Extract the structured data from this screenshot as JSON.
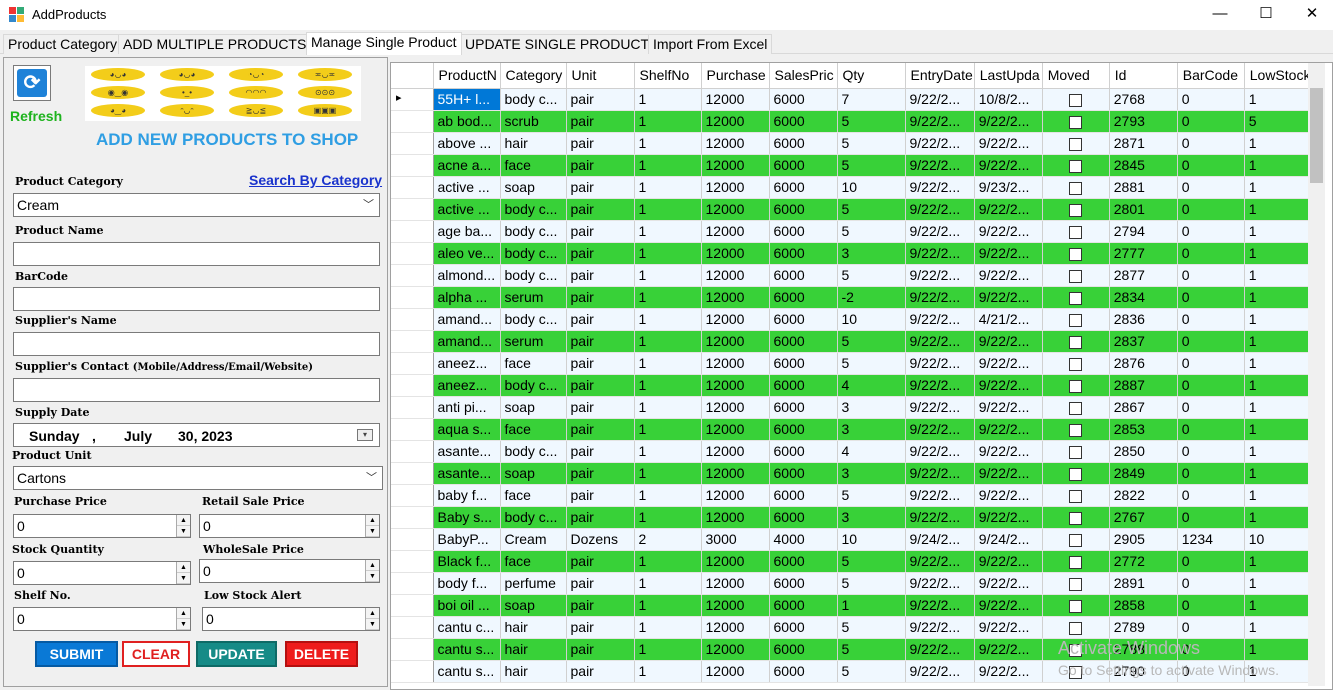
{
  "window": {
    "title": "AddProducts",
    "minimize": "—",
    "maximize": "☐",
    "close": "✕"
  },
  "tabs": [
    {
      "label": "Product Category"
    },
    {
      "label": "ADD MULTIPLE PRODUCTS"
    },
    {
      "label": "Manage Single Product"
    },
    {
      "label": "UPDATE SINGLE PRODUCT"
    },
    {
      "label": "Import From Excel"
    }
  ],
  "form": {
    "refresh_glyph": "⟳",
    "refresh_label": "Refresh",
    "heading": "ADD NEW PRODUCTS TO SHOP",
    "product_category_label": "Product Category",
    "search_by_category": "Search By Category",
    "product_category_value": "Cream",
    "product_name_label": "Product Name",
    "product_name_value": "",
    "barcode_label": "BarCode",
    "barcode_value": "",
    "supplier_name_label": "Supplier's Name",
    "supplier_name_value": "",
    "supplier_contact_label": "Supplier's Contact",
    "supplier_contact_hint": "(Mobile/Address/Email/Website)",
    "supplier_contact_value": "",
    "supply_date_label": "Supply Date",
    "supply_date": {
      "weekday": "Sunday",
      "sep": ",",
      "month": "July",
      "day_year": "30, 2023"
    },
    "product_unit_label": "Product Unit",
    "product_unit_value": "Cartons",
    "purchase_price_label": "Purchase Price",
    "purchase_price_value": "0",
    "retail_sale_price_label": "Retail Sale Price",
    "retail_sale_price_value": "0",
    "stock_quantity_label": "Stock Quantity",
    "stock_quantity_value": "0",
    "wholesale_price_label": "WholeSale Price",
    "wholesale_price_value": "0",
    "shelf_no_label": "Shelf No.",
    "shelf_no_value": "0",
    "low_stock_alert_label": "Low Stock Alert",
    "low_stock_alert_value": "0",
    "buttons": {
      "submit": "SUBMIT",
      "clear": "CLEAR",
      "update": "UPDATE",
      "delete": "DELETE"
    }
  },
  "grid": {
    "columns": [
      "ProductN",
      "Category",
      "Unit",
      "ShelfNo",
      "Purchase",
      "SalesPric",
      "Qty",
      "EntryDate",
      "LastUpda",
      "Moved",
      "Id",
      "BarCode",
      "LowStock"
    ],
    "rows": [
      [
        "55H+ l...",
        "body c...",
        "pair",
        "1",
        "12000",
        "6000",
        "7",
        "9/22/2...",
        "10/8/2...",
        "",
        "2768",
        "0",
        "1"
      ],
      [
        "ab bod...",
        "scrub",
        "pair",
        "1",
        "12000",
        "6000",
        "5",
        "9/22/2...",
        "9/22/2...",
        "",
        "2793",
        "0",
        "5"
      ],
      [
        "above ...",
        "hair",
        "pair",
        "1",
        "12000",
        "6000",
        "5",
        "9/22/2...",
        "9/22/2...",
        "",
        "2871",
        "0",
        "1"
      ],
      [
        "acne a...",
        "face",
        "pair",
        "1",
        "12000",
        "6000",
        "5",
        "9/22/2...",
        "9/22/2...",
        "",
        "2845",
        "0",
        "1"
      ],
      [
        "active ...",
        "soap",
        "pair",
        "1",
        "12000",
        "6000",
        "10",
        "9/22/2...",
        "9/23/2...",
        "",
        "2881",
        "0",
        "1"
      ],
      [
        "active ...",
        "body c...",
        "pair",
        "1",
        "12000",
        "6000",
        "5",
        "9/22/2...",
        "9/22/2...",
        "",
        "2801",
        "0",
        "1"
      ],
      [
        "age ba...",
        "body c...",
        "pair",
        "1",
        "12000",
        "6000",
        "5",
        "9/22/2...",
        "9/22/2...",
        "",
        "2794",
        "0",
        "1"
      ],
      [
        "aleo ve...",
        "body c...",
        "pair",
        "1",
        "12000",
        "6000",
        "3",
        "9/22/2...",
        "9/22/2...",
        "",
        "2777",
        "0",
        "1"
      ],
      [
        "almond...",
        "body c...",
        "pair",
        "1",
        "12000",
        "6000",
        "5",
        "9/22/2...",
        "9/22/2...",
        "",
        "2877",
        "0",
        "1"
      ],
      [
        "alpha ...",
        "serum",
        "pair",
        "1",
        "12000",
        "6000",
        "-2",
        "9/22/2...",
        "9/22/2...",
        "",
        "2834",
        "0",
        "1"
      ],
      [
        "amand...",
        "body c...",
        "pair",
        "1",
        "12000",
        "6000",
        "10",
        "9/22/2...",
        "4/21/2...",
        "",
        "2836",
        "0",
        "1"
      ],
      [
        "amand...",
        "serum",
        "pair",
        "1",
        "12000",
        "6000",
        "5",
        "9/22/2...",
        "9/22/2...",
        "",
        "2837",
        "0",
        "1"
      ],
      [
        "aneez...",
        "face",
        "pair",
        "1",
        "12000",
        "6000",
        "5",
        "9/22/2...",
        "9/22/2...",
        "",
        "2876",
        "0",
        "1"
      ],
      [
        "aneez...",
        "body c...",
        "pair",
        "1",
        "12000",
        "6000",
        "4",
        "9/22/2...",
        "9/22/2...",
        "",
        "2887",
        "0",
        "1"
      ],
      [
        "anti pi...",
        "soap",
        "pair",
        "1",
        "12000",
        "6000",
        "3",
        "9/22/2...",
        "9/22/2...",
        "",
        "2867",
        "0",
        "1"
      ],
      [
        "aqua s...",
        "face",
        "pair",
        "1",
        "12000",
        "6000",
        "3",
        "9/22/2...",
        "9/22/2...",
        "",
        "2853",
        "0",
        "1"
      ],
      [
        "asante...",
        "body c...",
        "pair",
        "1",
        "12000",
        "6000",
        "4",
        "9/22/2...",
        "9/22/2...",
        "",
        "2850",
        "0",
        "1"
      ],
      [
        "asante...",
        "soap",
        "pair",
        "1",
        "12000",
        "6000",
        "3",
        "9/22/2...",
        "9/22/2...",
        "",
        "2849",
        "0",
        "1"
      ],
      [
        "baby f...",
        "face",
        "pair",
        "1",
        "12000",
        "6000",
        "5",
        "9/22/2...",
        "9/22/2...",
        "",
        "2822",
        "0",
        "1"
      ],
      [
        "Baby s...",
        "body c...",
        "pair",
        "1",
        "12000",
        "6000",
        "3",
        "9/22/2...",
        "9/22/2...",
        "",
        "2767",
        "0",
        "1"
      ],
      [
        "BabyP...",
        "Cream",
        "Dozens",
        "2",
        "3000",
        "4000",
        "10",
        "9/24/2...",
        "9/24/2...",
        "",
        "2905",
        "1234",
        "10"
      ],
      [
        "Black f...",
        "face",
        "pair",
        "1",
        "12000",
        "6000",
        "5",
        "9/22/2...",
        "9/22/2...",
        "",
        "2772",
        "0",
        "1"
      ],
      [
        "body f...",
        "perfume",
        "pair",
        "1",
        "12000",
        "6000",
        "5",
        "9/22/2...",
        "9/22/2...",
        "",
        "2891",
        "0",
        "1"
      ],
      [
        "boi oil ...",
        "soap",
        "pair",
        "1",
        "12000",
        "6000",
        "1",
        "9/22/2...",
        "9/22/2...",
        "",
        "2858",
        "0",
        "1"
      ],
      [
        "cantu c...",
        "hair",
        "pair",
        "1",
        "12000",
        "6000",
        "5",
        "9/22/2...",
        "9/22/2...",
        "",
        "2789",
        "0",
        "1"
      ],
      [
        "cantu s...",
        "hair",
        "pair",
        "1",
        "12000",
        "6000",
        "5",
        "9/22/2...",
        "9/22/2...",
        "",
        "2788",
        "0",
        "1"
      ],
      [
        "cantu s...",
        "hair",
        "pair",
        "1",
        "12000",
        "6000",
        "5",
        "9/22/2...",
        "9/22/2...",
        "",
        "2790",
        "0",
        "1"
      ]
    ]
  },
  "watermark": {
    "line1": "Activate Windows",
    "line2": "Go to Settings to activate Windows."
  },
  "colors": {
    "accent_blue": "#0078d7",
    "row_green": "#38d138",
    "row_light": "#f0f8ff",
    "heading_blue": "#2f9ee3",
    "refresh_green": "#1db31d"
  }
}
